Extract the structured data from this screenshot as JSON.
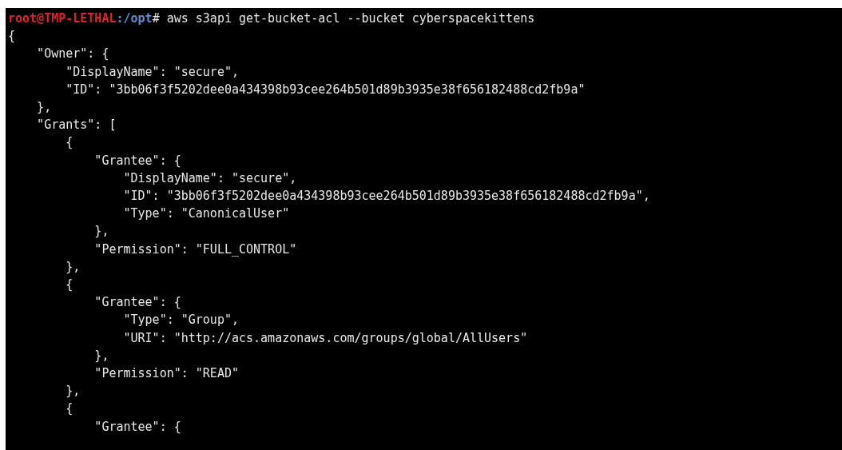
{
  "terminal": {
    "prompt": {
      "user_host": "root@TMP-LETHAL",
      "path": ":/opt",
      "symbol": "#",
      "command": "aws s3api get-bucket-acl --bucket cyberspacekittens"
    },
    "output_lines": [
      "{",
      "    \"Owner\": {",
      "        \"DisplayName\": \"secure\",",
      "        \"ID\": \"3bb06f3f5202dee0a434398b93cee264b501d89b3935e38f656182488cd2fb9a\"",
      "    },",
      "    \"Grants\": [",
      "        {",
      "            \"Grantee\": {",
      "                \"DisplayName\": \"secure\",",
      "                \"ID\": \"3bb06f3f5202dee0a434398b93cee264b501d89b3935e38f656182488cd2fb9a\",",
      "                \"Type\": \"CanonicalUser\"",
      "            },",
      "            \"Permission\": \"FULL_CONTROL\"",
      "        },",
      "        {",
      "            \"Grantee\": {",
      "                \"Type\": \"Group\",",
      "                \"URI\": \"http://acs.amazonaws.com/groups/global/AllUsers\"",
      "            },",
      "            \"Permission\": \"READ\"",
      "        },",
      "        {",
      "            \"Grantee\": {"
    ]
  }
}
